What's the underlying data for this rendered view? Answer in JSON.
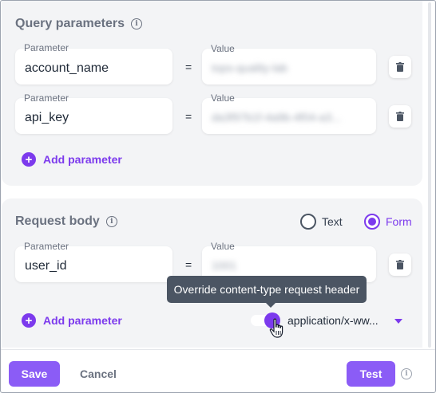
{
  "query_parameters": {
    "title": "Query parameters",
    "info_icon": "info-icon",
    "rows": [
      {
        "param_label": "Parameter",
        "param_value": "account_name",
        "equals": "=",
        "value_label": "Value",
        "value_value": "tops-quality-lab"
      },
      {
        "param_label": "Parameter",
        "param_value": "api_key",
        "equals": "=",
        "value_label": "Value",
        "value_value": "da3f97b1f-4a9b-4f04-a3..."
      }
    ],
    "add_label": "Add parameter"
  },
  "request_body": {
    "title": "Request body",
    "info_icon": "info-icon",
    "radio_text": "Text",
    "radio_form": "Form",
    "selected": "Form",
    "rows": [
      {
        "param_label": "Parameter",
        "param_value": "user_id",
        "equals": "=",
        "value_label": "Value",
        "value_value": "1001"
      }
    ],
    "add_label": "Add parameter",
    "tooltip": "Override content-type request header",
    "content_type": "application/x-ww...",
    "toggle_on": true
  },
  "footer": {
    "save_label": "Save",
    "cancel_label": "Cancel",
    "test_label": "Test"
  },
  "colors": {
    "accent": "#7c3aed",
    "button": "#8b5cf6",
    "tooltip_bg": "#4b5563",
    "panel_bg": "#f3f4f6"
  }
}
